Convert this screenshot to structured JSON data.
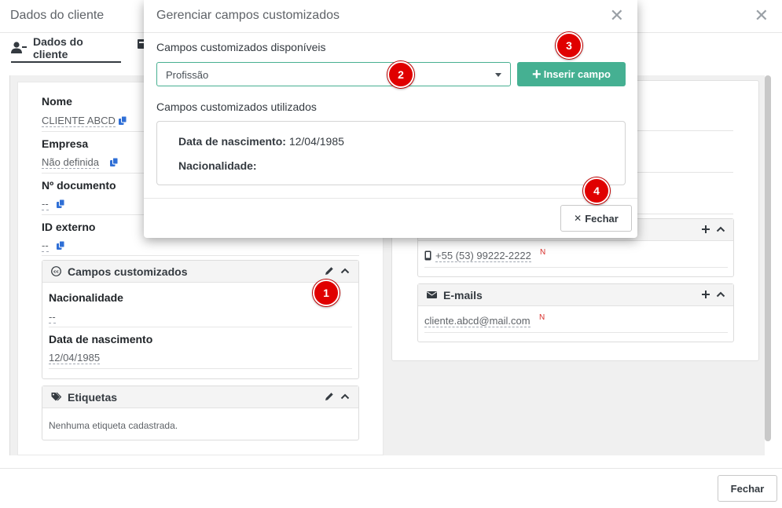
{
  "window": {
    "title": "Dados do cliente"
  },
  "tabs": [
    {
      "label": "Dados do cliente",
      "icon": "user-icon"
    }
  ],
  "client": {
    "name_label": "Nome",
    "name_value": "CLIENTE ABCD",
    "company_label": "Empresa",
    "company_value": "Não definida",
    "doc_label": "Nº documento",
    "doc_value": "--",
    "extid_label": "ID externo",
    "extid_value": "--"
  },
  "custom_fields_card": {
    "title": "Campos customizados",
    "fields": [
      {
        "label": "Nacionalidade",
        "value": "--"
      },
      {
        "label": "Data de nascimento",
        "value": "12/04/1985"
      }
    ]
  },
  "tags_card": {
    "title": "Etiquetas",
    "empty_text": "Nenhuma etiqueta cadastrada."
  },
  "phones": {
    "number": "+55 (53) 99222-2222",
    "flag": "N"
  },
  "emails_card": {
    "title": "E-mails",
    "address": "cliente.abcd@mail.com",
    "flag": "N"
  },
  "modal": {
    "title": "Gerenciar campos customizados",
    "available_label": "Campos customizados disponíveis",
    "select_value": "Profissão",
    "insert_button": "Inserir campo",
    "used_label": "Campos customizados utilizados",
    "used": [
      {
        "label": "Data de nascimento:",
        "value": "12/04/1985"
      },
      {
        "label": "Nacionalidade:",
        "value": ""
      }
    ],
    "close_button": "Fechar"
  },
  "footer": {
    "close_button": "Fechar"
  },
  "badges": [
    "1",
    "2",
    "3",
    "4"
  ],
  "colors": {
    "accent": "#45b092",
    "badge": "#e00000",
    "link": "#2f6fd6"
  }
}
